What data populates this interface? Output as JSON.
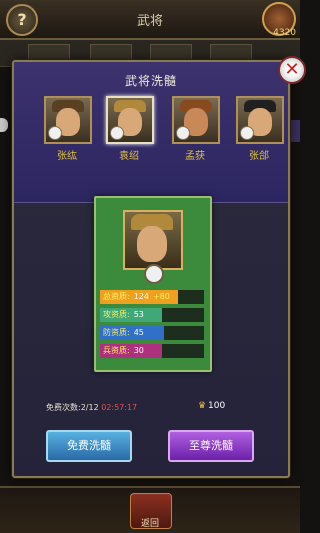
{
  "screen": {
    "title": "武将",
    "gold": "4320",
    "help_label": "?",
    "back_label": "返回"
  },
  "modal": {
    "title": "武将洗髓",
    "close_label": "✕",
    "heroes": [
      {
        "name": "张纮",
        "selected": false
      },
      {
        "name": "袁绍",
        "selected": true
      },
      {
        "name": "孟获",
        "selected": false
      },
      {
        "name": "张郃",
        "selected": false
      }
    ],
    "card": {
      "stats": [
        {
          "label": "总资质:",
          "value": "124",
          "bonus": "+80",
          "fill": 0.75,
          "color": "#f0a020"
        },
        {
          "label": "攻资质:",
          "value": "53",
          "bonus": "",
          "fill": 0.6,
          "color": "#40a878"
        },
        {
          "label": "防资质:",
          "value": "45",
          "bonus": "",
          "fill": 0.62,
          "color": "#3070c8"
        },
        {
          "label": "兵资质:",
          "value": "30",
          "bonus": "",
          "fill": 0.6,
          "color": "#b03080"
        }
      ]
    },
    "free_count_label": "免费次数:",
    "free_count_value": "2/12",
    "free_timer": "02:57:17",
    "crown_icon": "♛",
    "crown_amount": "100",
    "free_button": "免费洗髓",
    "supreme_button": "至尊洗髓"
  }
}
